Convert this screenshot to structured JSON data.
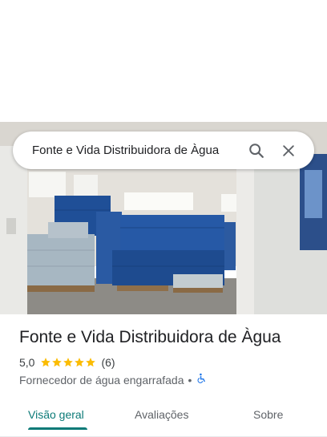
{
  "search": {
    "query": "Fonte e Vida Distribuidora de Àgua",
    "search_icon": "search-icon",
    "close_icon": "close-icon"
  },
  "place": {
    "name": "Fonte e Vida Distribuidora de Àgua",
    "rating": "5,0",
    "rating_value": 5.0,
    "review_count": "(6)",
    "category": "Fornecedor de água engarrafada",
    "separator": "•",
    "accessibility_icon": "wheelchair-icon"
  },
  "tabs": [
    {
      "label": "Visão geral",
      "active": true
    },
    {
      "label": "Avaliações",
      "active": false
    },
    {
      "label": "Sobre",
      "active": false
    }
  ],
  "colors": {
    "accent": "#0b7a77",
    "star": "#fbbc04",
    "accessibility": "#1a73e8"
  }
}
